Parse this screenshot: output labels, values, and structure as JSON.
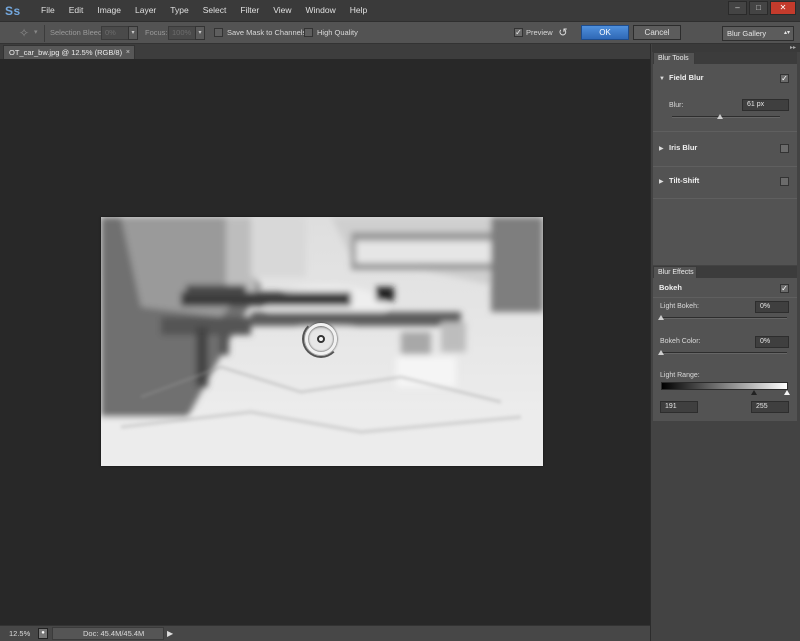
{
  "app": {
    "logo": "Ss"
  },
  "menu": [
    "File",
    "Edit",
    "Image",
    "Layer",
    "Type",
    "Select",
    "Filter",
    "View",
    "Window",
    "Help"
  ],
  "window_controls": {
    "minimize": "–",
    "maximize": "□",
    "close": "✕"
  },
  "options": {
    "tool_icon": "pin-icon",
    "selection_bleed_label": "Selection Bleed:",
    "selection_bleed_value": "0%",
    "focus_label": "Focus:",
    "focus_value": "100%",
    "save_mask_label": "Save Mask to Channels",
    "save_mask_checked": false,
    "high_quality_label": "High Quality",
    "high_quality_checked": false,
    "preview_label": "Preview",
    "preview_checked": true,
    "ok_label": "OK",
    "cancel_label": "Cancel",
    "workspace": "Blur Gallery"
  },
  "document": {
    "tab_title": "OT_car_bw.jpg @ 12.5% (RGB/8)",
    "close_glyph": "×"
  },
  "status": {
    "zoom": "12.5%",
    "doc_info": "Doc: 45.4M/45.4M",
    "arrow": "▶"
  },
  "blur_tools": {
    "tab": "Blur Tools",
    "field_blur": {
      "label": "Field Blur",
      "expanded": true,
      "checked": true,
      "blur_label": "Blur:",
      "blur_value": "61 px",
      "slider_fraction": 0.44
    },
    "iris_blur": {
      "label": "Iris Blur",
      "expanded": false,
      "checked": false
    },
    "tilt_shift": {
      "label": "Tilt-Shift",
      "expanded": false,
      "checked": false
    }
  },
  "blur_effects": {
    "tab": "Blur Effects",
    "bokeh_label": "Bokeh",
    "bokeh_checked": true,
    "light_bokeh_label": "Light Bokeh:",
    "light_bokeh_value": "0%",
    "light_bokeh_fraction": 0.0,
    "bokeh_color_label": "Bokeh Color:",
    "bokeh_color_value": "0%",
    "bokeh_color_fraction": 0.0,
    "light_range_label": "Light Range:",
    "light_range_low": "191",
    "light_range_high": "255"
  },
  "colors": {
    "accent": "#3a7bd5",
    "canvas_bg": "#282828",
    "panel_bg": "#535353"
  }
}
